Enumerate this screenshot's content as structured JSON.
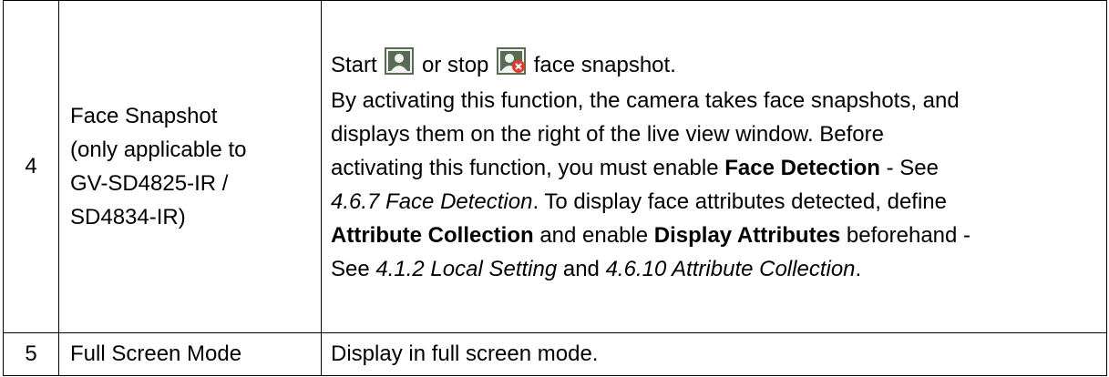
{
  "rows": [
    {
      "number": "4",
      "feature_lines": [
        "Face Snapshot",
        "(only applicable to",
        "GV-SD4825-IR /",
        "SD4834-IR)"
      ],
      "description": {
        "line1_start": "Start",
        "line1_or_stop": "or stop",
        "line1_end": "face snapshot.",
        "p1": "By activating this function, the camera takes face snapshots, and",
        "p2": "displays them on the right of the live view window. Before",
        "p3_a": "activating this function, you must enable ",
        "p3_b": "Face Detection",
        "p3_c": " - See",
        "p4_a": "4.6.7 Face Detection",
        "p4_b": ". To display face attributes detected, define",
        "p5_a": "Attribute Collection",
        "p5_b": " and enable ",
        "p5_c": "Display Attributes",
        "p5_d": " beforehand -",
        "p6_a": "See ",
        "p6_b": "4.1.2 Local Setting",
        "p6_c": " and ",
        "p6_d": "4.6.10 Attribute Collection",
        "p6_e": "."
      },
      "icons": [
        "face-snapshot-start-icon",
        "face-snapshot-stop-icon"
      ]
    },
    {
      "number": "5",
      "feature": "Full Screen Mode",
      "description": "Display in full screen mode."
    }
  ],
  "colors": {
    "icon_dark": "#5a6b54",
    "icon_light": "#f2f2f2",
    "stop_red": "#e23b2a"
  }
}
